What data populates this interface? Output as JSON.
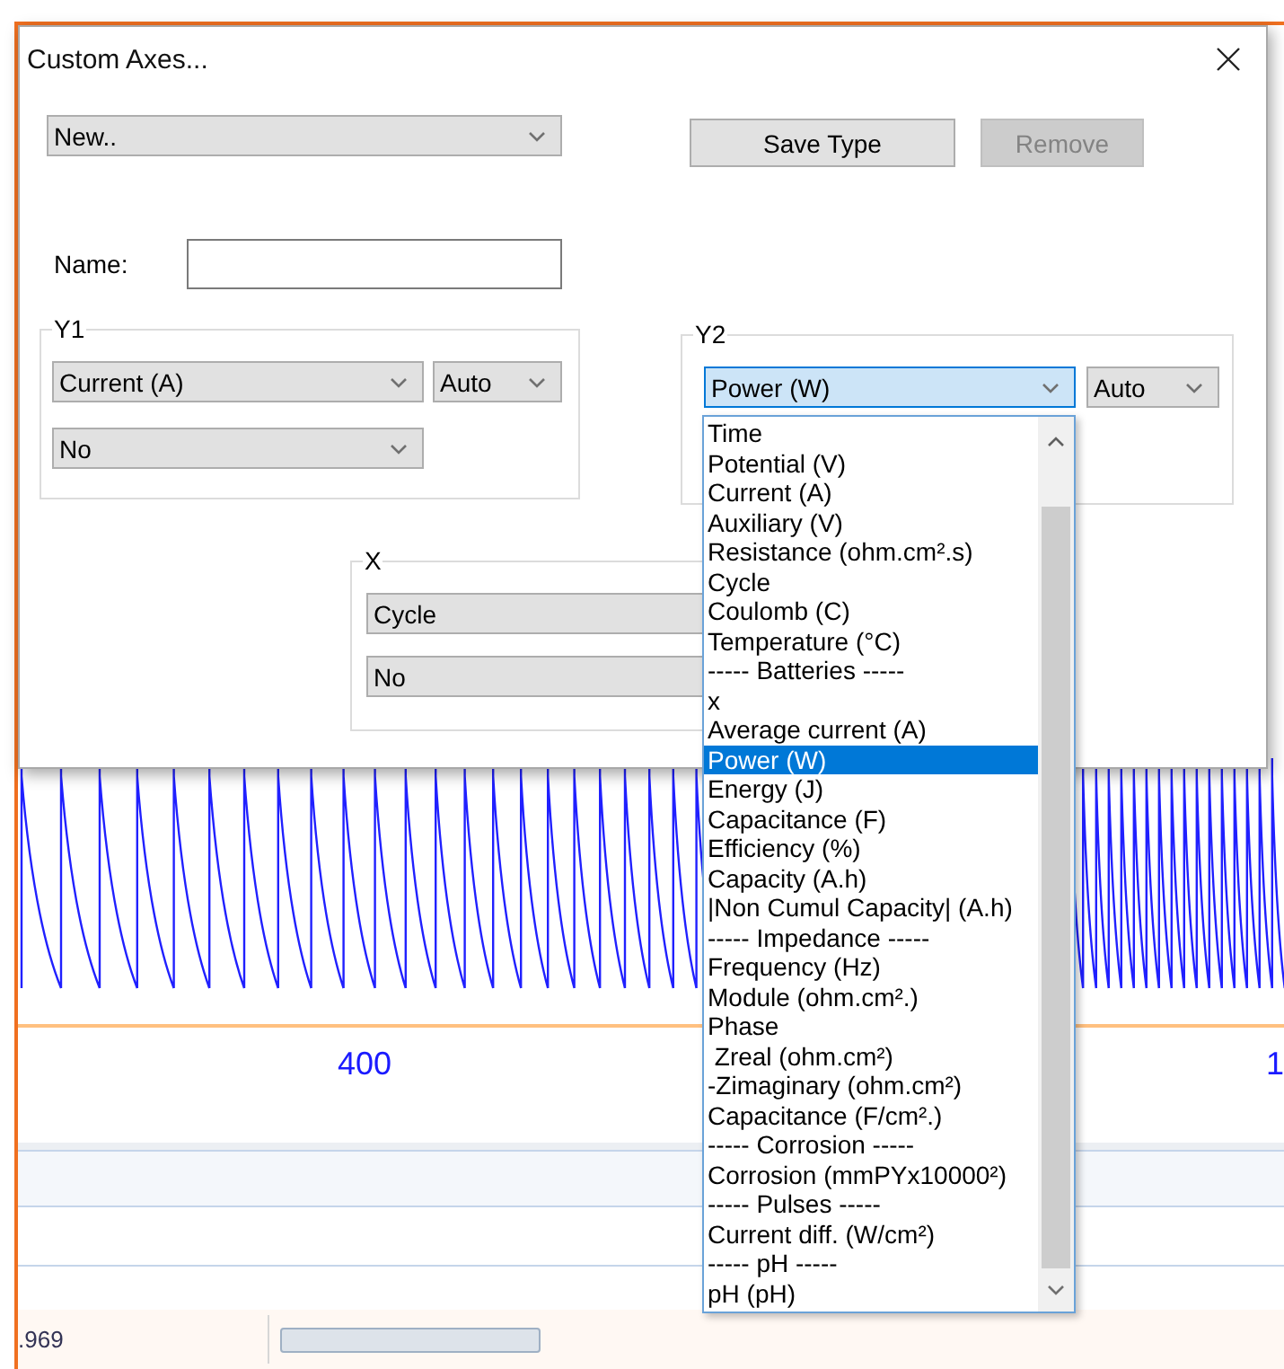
{
  "window": {
    "title": "Custom Axes..."
  },
  "type_select": {
    "value": "New.."
  },
  "buttons": [
    {
      "label": "Save Type",
      "disabled": false
    },
    {
      "label": "Remove",
      "disabled": true
    }
  ],
  "name_field": {
    "label": "Name:"
  },
  "groups": [
    {
      "label": "Y1",
      "quantity": "Current (A)",
      "scale": "Auto",
      "option": "No",
      "focused": false
    },
    {
      "label": "Y2",
      "quantity": "Power (W)",
      "scale": "Auto",
      "focused": true
    },
    {
      "label": "X",
      "quantity": "Cycle",
      "option": "No",
      "focused": false
    }
  ],
  "dropdown": {
    "items": [
      {
        "label": "Time",
        "selected": false
      },
      {
        "label": "Potential (V)",
        "selected": false
      },
      {
        "label": "Current (A)",
        "selected": false
      },
      {
        "label": "Auxiliary (V)",
        "selected": false
      },
      {
        "label": "Resistance (ohm.cm².s)",
        "selected": false
      },
      {
        "label": "Cycle",
        "selected": false
      },
      {
        "label": "Coulomb (C)",
        "selected": false
      },
      {
        "label": "Temperature (°C)",
        "selected": false
      },
      {
        "label": "----- Batteries -----",
        "selected": false
      },
      {
        "label": "x",
        "selected": false
      },
      {
        "label": "Average current (A)",
        "selected": false
      },
      {
        "label": "Power (W)",
        "selected": true
      },
      {
        "label": "Energy (J)",
        "selected": false
      },
      {
        "label": "Capacitance (F)",
        "selected": false
      },
      {
        "label": "Efficiency (%)",
        "selected": false
      },
      {
        "label": "Capacity (A.h)",
        "selected": false
      },
      {
        "label": "|Non Cumul Capacity| (A.h)",
        "selected": false
      },
      {
        "label": "----- Impedance -----",
        "selected": false
      },
      {
        "label": "Frequency (Hz)",
        "selected": false
      },
      {
        "label": "Module (ohm.cm².)",
        "selected": false
      },
      {
        "label": "Phase",
        "selected": false
      },
      {
        "label": " Zreal (ohm.cm²)",
        "selected": false
      },
      {
        "label": "-Zimaginary (ohm.cm²)",
        "selected": false
      },
      {
        "label": "Capacitance (F/cm².)",
        "selected": false
      },
      {
        "label": "----- Corrosion -----",
        "selected": false
      },
      {
        "label": "Corrosion (mmPYx10000²)",
        "selected": false
      },
      {
        "label": "----- Pulses -----",
        "selected": false
      },
      {
        "label": "Current diff. (W/cm²)",
        "selected": false
      },
      {
        "label": "----- pH -----",
        "selected": false
      },
      {
        "label": "pH (pH)",
        "selected": false
      }
    ]
  },
  "background": {
    "axis_labels": [
      "400",
      "1"
    ],
    "status_value": ".969"
  }
}
